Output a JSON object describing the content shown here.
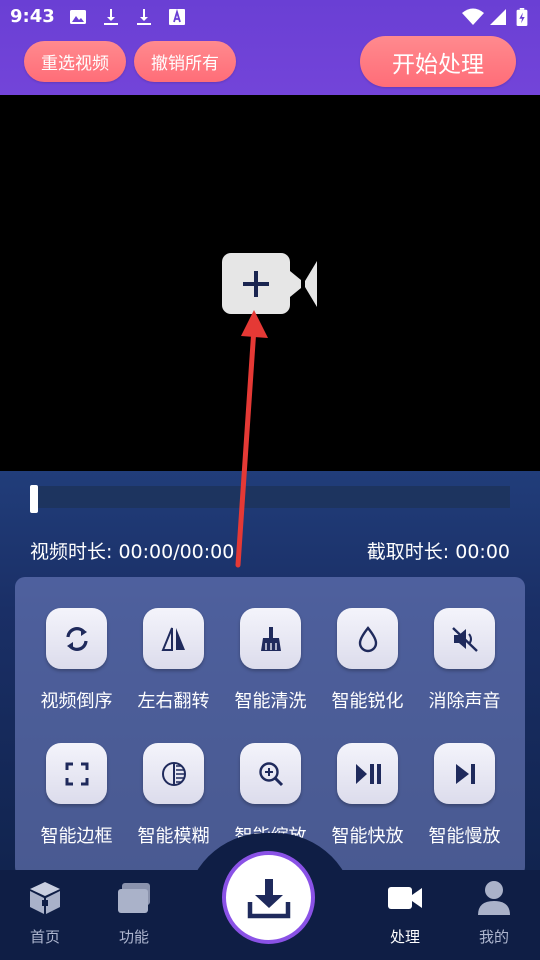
{
  "status": {
    "time": "9:43"
  },
  "header": {
    "reselect_label": "重选视频",
    "undo_all_label": "撤销所有",
    "start_label": "开始处理"
  },
  "player": {
    "video_duration": "视频时长: 00:00/00:00",
    "clip_duration": "截取时长: 00:00"
  },
  "tools": [
    {
      "label": "视频倒序",
      "icon": "refresh-icon"
    },
    {
      "label": "左右翻转",
      "icon": "flip-horizontal-icon"
    },
    {
      "label": "智能清洗",
      "icon": "broom-icon"
    },
    {
      "label": "智能锐化",
      "icon": "droplet-icon"
    },
    {
      "label": "消除声音",
      "icon": "mute-icon"
    },
    {
      "label": "智能边框",
      "icon": "frame-icon"
    },
    {
      "label": "智能模糊",
      "icon": "blur-icon"
    },
    {
      "label": "智能缩放",
      "icon": "zoom-icon"
    },
    {
      "label": "智能快放",
      "icon": "play-pause-icon"
    },
    {
      "label": "智能慢放",
      "icon": "slow-play-icon"
    }
  ],
  "nav": [
    {
      "label": "首页",
      "icon": "home-cube-icon"
    },
    {
      "label": "功能",
      "icon": "folder-icon"
    },
    {
      "label": "处理",
      "icon": "video-camera-icon",
      "active": true
    },
    {
      "label": "我的",
      "icon": "user-icon"
    }
  ],
  "colors": {
    "header": "#6a3fd4",
    "accent_pill": "#ff6d78",
    "panel": "#1a2f66",
    "fab_ring": "#8a52e6",
    "arrow": "#e53935"
  }
}
